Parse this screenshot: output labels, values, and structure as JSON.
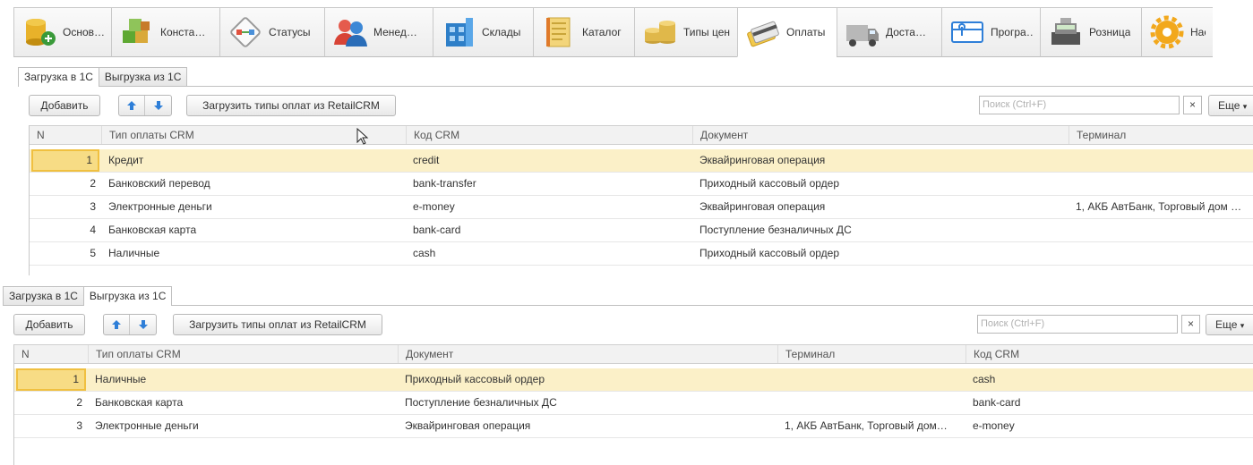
{
  "top_tabs": [
    {
      "label": "Основ…",
      "icon": "database-icon"
    },
    {
      "label": "Конста…",
      "icon": "building-blocks-icon"
    },
    {
      "label": "Статусы",
      "icon": "flow-icon"
    },
    {
      "label": "Менед…",
      "icon": "users-icon"
    },
    {
      "label": "Склады",
      "icon": "warehouse-icon"
    },
    {
      "label": "Каталог",
      "icon": "book-icon"
    },
    {
      "label": "Типы цен",
      "icon": "coins-icon"
    },
    {
      "label": "Оплаты",
      "icon": "card-icon",
      "active": true
    },
    {
      "label": "Доста…",
      "icon": "truck-icon"
    },
    {
      "label": "Програ…",
      "icon": "gift-card-icon"
    },
    {
      "label": "Розница",
      "icon": "cash-register-icon"
    },
    {
      "label": "Настр",
      "icon": "gear-icon"
    }
  ],
  "upper": {
    "subtabs": [
      "Загрузка в 1С",
      "Выгрузка из 1С"
    ],
    "toolbar": {
      "add": "Добавить",
      "load": "Загрузить типы оплат из RetailCRM",
      "search_placeholder": "Поиск (Ctrl+F)",
      "clear": "×",
      "more": "Еще"
    },
    "columns": [
      "N",
      "Тип оплаты CRM",
      "Код CRM",
      "Документ",
      "Терминал"
    ],
    "rows": [
      [
        "1",
        "Кредит",
        "credit",
        "Эквайринговая операция",
        ""
      ],
      [
        "2",
        "Банковский перевод",
        "bank-transfer",
        "Приходный кассовый ордер",
        ""
      ],
      [
        "3",
        "Электронные деньги",
        "e-money",
        "Эквайринговая операция",
        "1, АКБ АвтБанк, Торговый дом …"
      ],
      [
        "4",
        "Банковская карта",
        "bank-card",
        "Поступление безналичных ДС",
        ""
      ],
      [
        "5",
        "Наличные",
        "cash",
        "Приходный кассовый ордер",
        ""
      ]
    ]
  },
  "lower": {
    "subtabs": [
      "Загрузка в 1С",
      "Выгрузка из 1С"
    ],
    "toolbar": {
      "add": "Добавить",
      "load": "Загрузить типы оплат из RetailCRM",
      "search_placeholder": "Поиск (Ctrl+F)",
      "clear": "×",
      "more": "Еще"
    },
    "columns": [
      "N",
      "Тип оплаты CRM",
      "Документ",
      "Терминал",
      "Код CRM"
    ],
    "rows": [
      [
        "1",
        "Наличные",
        "Приходный кассовый ордер",
        "",
        "cash"
      ],
      [
        "2",
        "Банковская карта",
        "Поступление безналичных ДС",
        "",
        "bank-card"
      ],
      [
        "3",
        "Электронные деньги",
        "Эквайринговая операция",
        "1, АКБ АвтБанк, Торговый дом…",
        "e-money"
      ]
    ]
  },
  "colors": {
    "accent_row": "#fbf0c8",
    "focus_cell": "#f7dc85",
    "arrow_blue": "#2f7fd8"
  }
}
